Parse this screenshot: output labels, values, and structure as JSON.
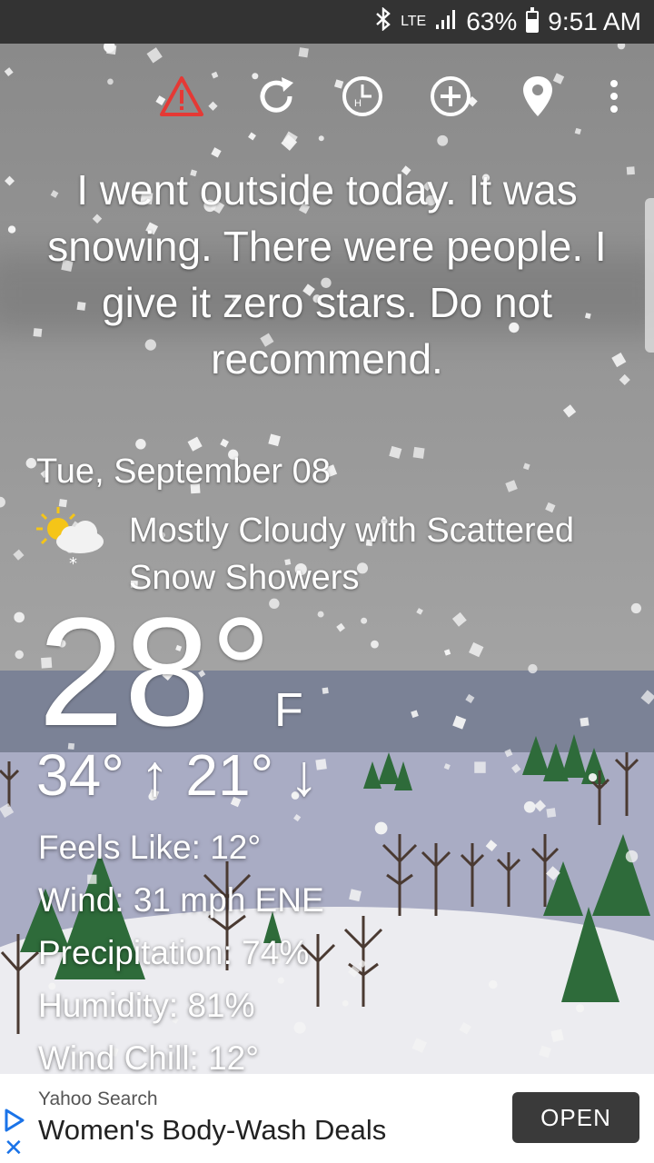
{
  "status_bar": {
    "bluetooth_icon": "bluetooth-icon",
    "network": "LTE",
    "signal_icon": "signal-icon",
    "battery_percent": "63%",
    "battery_level": 0.63,
    "time": "9:51 AM"
  },
  "toolbar": {
    "icons": [
      "warning-icon",
      "refresh-icon",
      "hourly-forecast-icon",
      "add-location-icon",
      "location-pin-icon",
      "more-vert-icon"
    ],
    "warning_color": "#e53935"
  },
  "quote": "I went outside today. It was snowing. There were people. I give it zero stars. Do not recommend.",
  "weather": {
    "date": "Tue, September 08",
    "condition_icon": "partly-cloudy-snow-icon",
    "condition": "Mostly Cloudy with Scattered Snow Showers",
    "temperature": "28°",
    "unit": "F",
    "high_low": "34° ↑ 21° ↓",
    "details": [
      "Feels Like: 12°",
      "Wind: 31 mph ENE",
      "Precipitation: 74%",
      "Humidity: 81%",
      "Wind Chill: 12°"
    ]
  },
  "ad": {
    "source": "Yahoo Search",
    "title": "Women's Body-Wash Deals",
    "cta": "OPEN",
    "adchoices_icon": "adchoices-play-icon",
    "close_icon": "close-icon"
  },
  "colors": {
    "status_bar": "#333333",
    "sky": "#8e8e8e",
    "ad_button": "#3a3a3a",
    "adchoices": "#1a73e8",
    "tree_green": "#2e6b3a"
  }
}
